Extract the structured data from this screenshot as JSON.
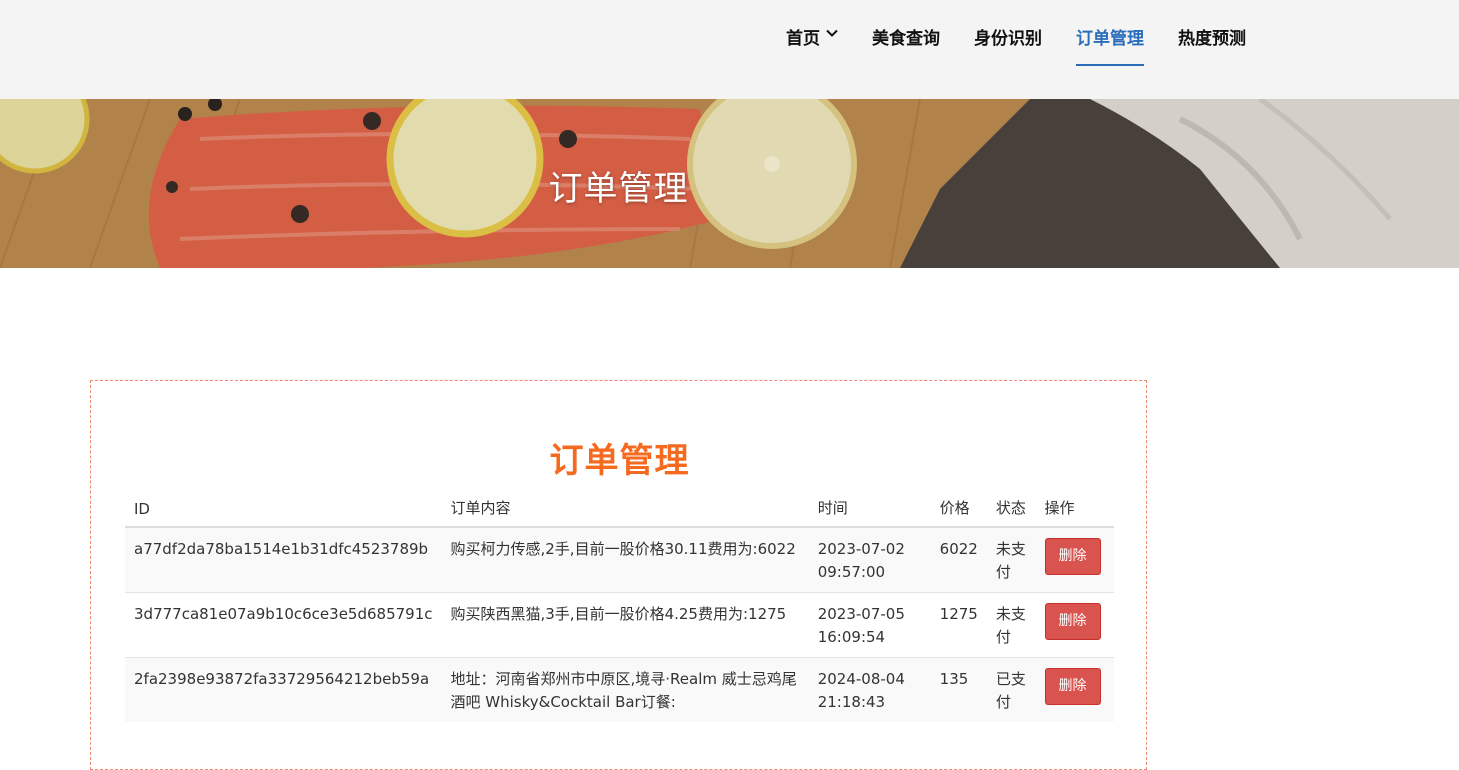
{
  "nav": {
    "items": [
      {
        "label": "首页",
        "dropdown": true,
        "active": false
      },
      {
        "label": "美食查询",
        "dropdown": false,
        "active": false
      },
      {
        "label": "身份识别",
        "dropdown": false,
        "active": false
      },
      {
        "label": "订单管理",
        "dropdown": false,
        "active": true
      },
      {
        "label": "热度预测",
        "dropdown": false,
        "active": false
      }
    ],
    "active_color": "#2a6ebb"
  },
  "banner": {
    "title": "订单管理"
  },
  "main": {
    "title": "订单管理",
    "title_color": "#f56a1e",
    "table": {
      "columns": [
        "ID",
        "订单内容",
        "时间",
        "价格",
        "状态",
        "操作"
      ],
      "rows": [
        {
          "id": "a77df2da78ba1514e1b31dfc4523789b",
          "content": "购买柯力传感,2手,目前一股价格30.11费用为:6022",
          "time": "2023-07-02 09:57:00",
          "price": "6022",
          "status": "未支付",
          "action": "删除"
        },
        {
          "id": "3d777ca81e07a9b10c6ce3e5d685791c",
          "content": "购买陕西黑猫,3手,目前一股价格4.25费用为:1275",
          "time": "2023-07-05 16:09:54",
          "price": "1275",
          "status": "未支付",
          "action": "删除"
        },
        {
          "id": "2fa2398e93872fa33729564212beb59a",
          "content": "地址：河南省郑州市中原区,境寻·Realm 威士忌鸡尾酒吧 Whisky&Cocktail Bar订餐:",
          "time": "2024-08-04 21:18:43",
          "price": "135",
          "status": "已支付",
          "action": "删除"
        }
      ]
    },
    "delete_button_color": "#d9534f"
  }
}
